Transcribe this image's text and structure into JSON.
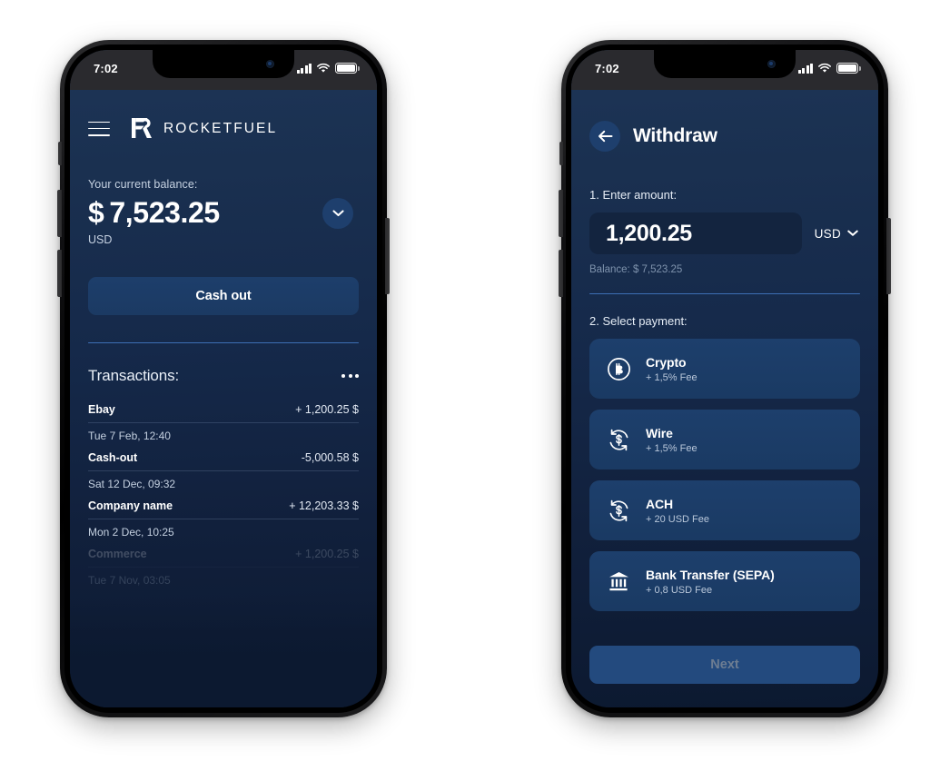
{
  "statusbar": {
    "time": "7:02",
    "signal_icon": "signal-bars-icon",
    "wifi_icon": "wifi-icon",
    "battery_icon": "battery-icon"
  },
  "phone1": {
    "menu_icon": "hamburger-menu-icon",
    "logo_icon": "rocketfuel-logo-icon",
    "brand": "ROCKETFUEL",
    "balance": {
      "label": "Your current balance:",
      "currency_symbol": "$",
      "amount": "7,523.25",
      "currency": "USD",
      "expand_icon": "chevron-down-icon"
    },
    "cash_out_label": "Cash out",
    "transactions": {
      "title": "Transactions:",
      "more_icon": "more-options-icon",
      "items": [
        {
          "name": "Ebay",
          "amount": "+ 1,200.25 $",
          "date": "Tue 7 Feb, 12:40"
        },
        {
          "name": "Cash-out",
          "amount": "-5,000.58 $",
          "date": "Sat 12 Dec, 09:32"
        },
        {
          "name": "Company name",
          "amount": "+ 12,203.33 $",
          "date": "Mon 2 Dec, 10:25"
        },
        {
          "name": "Commerce",
          "amount": "+ 1,200.25 $",
          "date": "Tue 7 Nov, 03:05"
        }
      ]
    }
  },
  "phone2": {
    "back_icon": "back-arrow-icon",
    "title": "Withdraw",
    "step1_label": "1. Enter amount:",
    "amount_value": "1,200.25",
    "currency": "USD",
    "currency_icon": "chevron-down-icon",
    "balance_note": "Balance: $ 7,523.25",
    "step2_label": "2. Select payment:",
    "payment_methods": [
      {
        "name": "Crypto",
        "fee": "+ 1,5% Fee",
        "icon": "bitcoin-coin-icon"
      },
      {
        "name": "Wire",
        "fee": "+ 1,5% Fee",
        "icon": "dollar-exchange-icon"
      },
      {
        "name": "ACH",
        "fee": "+ 20 USD Fee",
        "icon": "dollar-exchange-icon"
      },
      {
        "name": "Bank Transfer (SEPA)",
        "fee": "+ 0,8 USD Fee",
        "icon": "bank-building-icon"
      }
    ],
    "next_label": "Next"
  },
  "colors": {
    "screen_top": "#1d3557",
    "screen_bottom": "#0c1930",
    "accent": "#3d6fb5",
    "card": "#1d3f6c",
    "input": "#13243f",
    "next_button": "#234a7e"
  }
}
